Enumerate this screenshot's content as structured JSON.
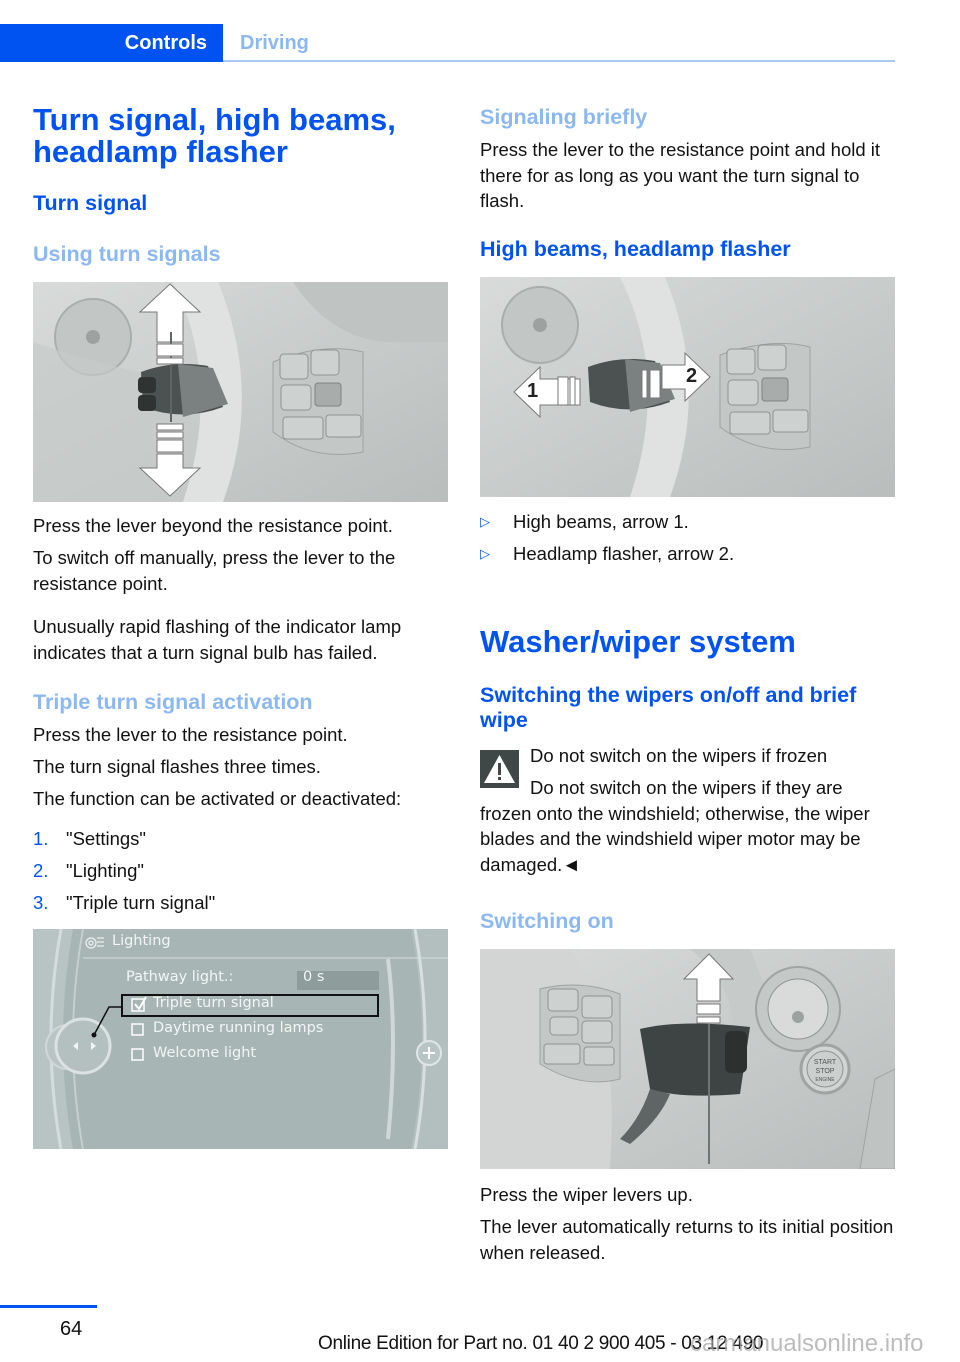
{
  "header": {
    "active_tab": "Controls",
    "inactive_tab": "Driving"
  },
  "left": {
    "title": "Turn signal, high beams, headlamp flasher",
    "section_turn_signal": "Turn signal",
    "subsection_using": "Using turn signals",
    "figure_turn_signal_alt": "Turn signal lever with up and down arrows",
    "p1": "Press the lever beyond the resistance point.",
    "p2": "To switch off manually, press the lever to the resistance point.",
    "p3": "Unusually rapid flashing of the indicator lamp indicates that a turn signal bulb has failed.",
    "subsection_triple": "Triple turn signal activation",
    "p4": "Press the lever to the resistance point.",
    "p5": "The turn signal flashes three times.",
    "p6": "The function can be activated or deactivated:",
    "steps": [
      {
        "num": "1.",
        "text": "\"Settings\""
      },
      {
        "num": "2.",
        "text": "\"Lighting\""
      },
      {
        "num": "3.",
        "text": "\"Triple turn signal\""
      }
    ],
    "menu_figure": {
      "title": "Lighting",
      "pathway_label": "Pathway light.:",
      "pathway_value": "0 s",
      "options": [
        {
          "label": "Triple turn signal",
          "checked": true
        },
        {
          "label": "Daytime running lamps",
          "checked": false
        },
        {
          "label": "Welcome light",
          "checked": false
        }
      ]
    }
  },
  "right": {
    "subsection_brief": "Signaling briefly",
    "p_brief": "Press the lever to the resistance point and hold it there for as long as you want the turn signal to flash.",
    "section_high_beams": "High beams, headlamp flasher",
    "figure_high_beams_labels": [
      "1",
      "2"
    ],
    "bullets": [
      "High beams, arrow 1.",
      "Headlamp flasher, arrow 2."
    ],
    "title_washer": "Washer/wiper system",
    "section_wipers": "Switching the wipers on/off and brief wipe",
    "warning_title": "Do not switch on the wipers if frozen",
    "warning_body": "Do not switch on the wipers if they are frozen onto the windshield; otherwise, the wiper blades and the windshield wiper motor may be damaged.◄",
    "subsection_switching_on": "Switching on",
    "figure_wiper_labels": [
      "START",
      "STOP",
      "ENGINE"
    ],
    "p_press": "Press the wiper levers up.",
    "p_returns": "The lever automatically returns to its initial position when released."
  },
  "footer": {
    "page_number": "64",
    "edition": "Online Edition for Part no. 01 40 2 900 405 - 03 12 490",
    "watermark": "carmanualsonline.info"
  }
}
